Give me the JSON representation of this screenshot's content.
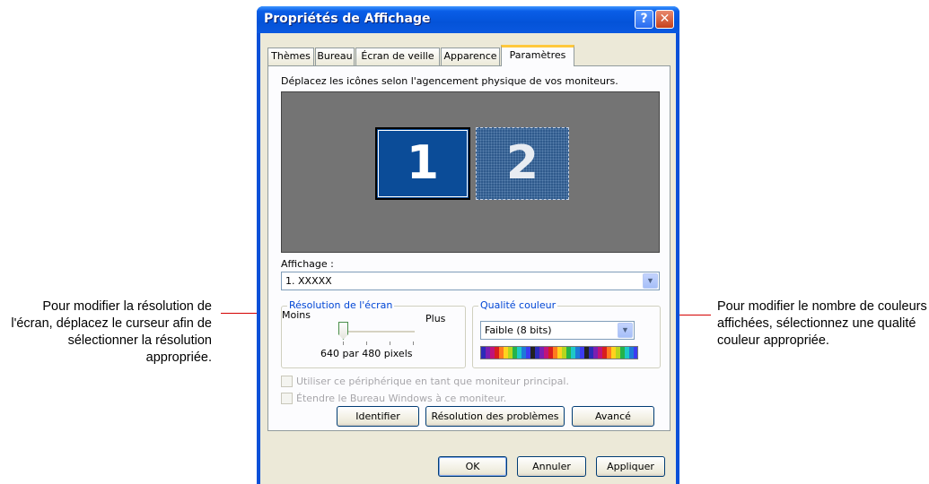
{
  "window": {
    "title": "Propriétés de Affichage"
  },
  "tabs": [
    "Thèmes",
    "Bureau",
    "Écran de veille",
    "Apparence",
    "Paramètres"
  ],
  "instruction": "Déplacez les icônes selon l'agencement physique de vos moniteurs.",
  "monitors": {
    "m1": "1",
    "m2": "2"
  },
  "display": {
    "label": "Affichage :",
    "value": "1. XXXXX"
  },
  "resolution": {
    "group_title": "Résolution de l'écran",
    "min_label": "Moins",
    "max_label": "Plus",
    "value_text": "640 par 480 pixels",
    "slider_level": 0.0
  },
  "color_quality": {
    "group_title": "Qualité couleur",
    "value": "Faible (8 bits)"
  },
  "checkboxes": {
    "primary": "Utiliser ce périphérique en tant que moniteur principal.",
    "extend": "Étendre le Bureau Windows à ce moniteur."
  },
  "buttons": {
    "identify": "Identifier",
    "troubleshoot": "Résolution des problèmes",
    "advanced": "Avancé",
    "ok": "OK",
    "cancel": "Annuler",
    "apply": "Appliquer"
  },
  "callouts": {
    "left": "Pour modifier la résolution de l'écran, déplacez le curseur afin de sélectionner la résolution appropriée.",
    "right": "Pour modifier le nombre de couleurs affichées, sélectionnez une qualité couleur appropriée."
  },
  "colors": {
    "title_bar": "#0453d8",
    "callout_line": "#d40000",
    "dialog_bg": "#ece9d8"
  }
}
